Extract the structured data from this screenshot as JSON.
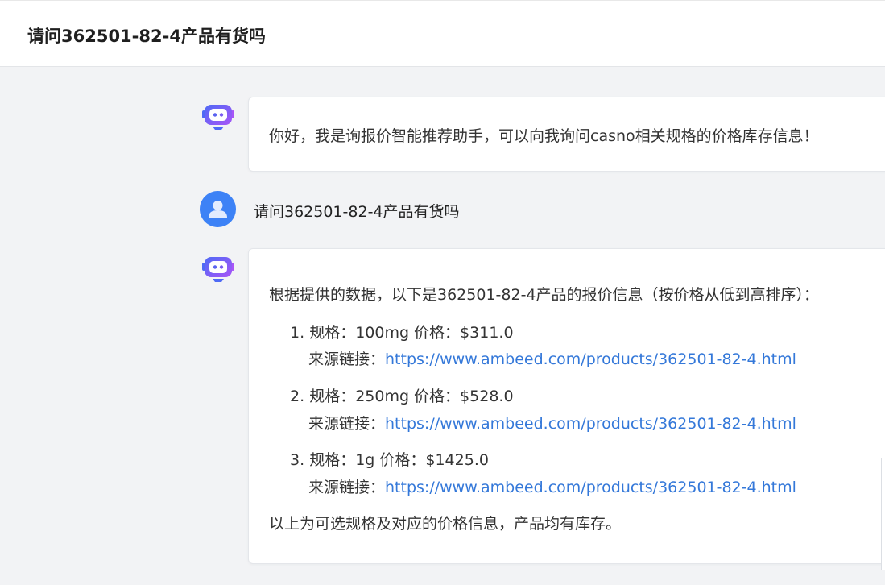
{
  "header": {
    "title": "请问362501-82-4产品有货吗"
  },
  "messages": {
    "bot_greeting": "你好，我是询报价智能推荐助手，可以向我询问casno相关规格的价格库存信息！",
    "user_question": "请问362501-82-4产品有货吗",
    "bot_reply": {
      "intro": "根据提供的数据，以下是362501-82-4产品的报价信息（按价格从低到高排序）：",
      "items": [
        {
          "index": "1.",
          "spec_line": "规格：100mg 价格：$311.0",
          "source_label": "来源链接：",
          "url": "https://www.ambeed.com/products/362501-82-4.html"
        },
        {
          "index": "2.",
          "spec_line": "规格：250mg 价格：$528.0",
          "source_label": "来源链接：",
          "url": "https://www.ambeed.com/products/362501-82-4.html"
        },
        {
          "index": "3.",
          "spec_line": "规格：1g 价格：$1425.0",
          "source_label": "来源链接：",
          "url": "https://www.ambeed.com/products/362501-82-4.html"
        }
      ],
      "outro": "以上为可选规格及对应的价格信息，产品均有库存。"
    }
  },
  "icons": {
    "bot": "robot-icon",
    "user": "user-icon"
  },
  "colors": {
    "link": "#3478d9",
    "user_avatar": "#3d82f6",
    "bot_gradient_start": "#4f6af5",
    "bot_gradient_end": "#a855f7"
  }
}
